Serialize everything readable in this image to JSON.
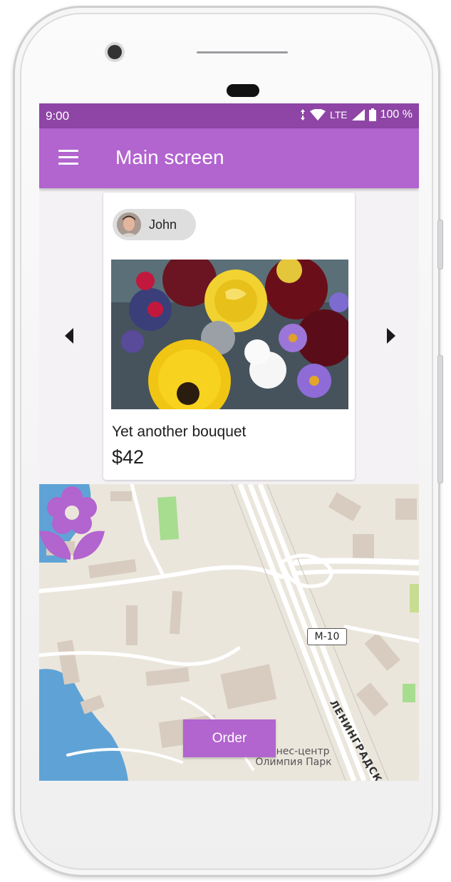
{
  "status_bar": {
    "time": "9:00",
    "network": "LTE",
    "battery": "100 %",
    "icons": [
      "data-arrows-icon",
      "wifi-icon",
      "signal-icon",
      "battery-icon"
    ]
  },
  "app_bar": {
    "menu_icon": "hamburger-menu-icon",
    "title": "Main screen"
  },
  "carousel": {
    "prev_icon": "arrow-left-icon",
    "next_icon": "arrow-right-icon",
    "card": {
      "user_name": "John",
      "title": "Yet another bouquet",
      "price": "$42"
    }
  },
  "map": {
    "road_shield": "M-10",
    "road_name": "ЛЕНИНГРАДСК",
    "poi_line1": "Бизнес-центр",
    "poi_line2": "Олимпия Парк",
    "marker_icon": "flower-icon"
  },
  "order_button": {
    "label": "Order"
  },
  "colors": {
    "primary": "#b264cf",
    "status_bar": "#8e45a6",
    "water": "#5fa3d6"
  }
}
